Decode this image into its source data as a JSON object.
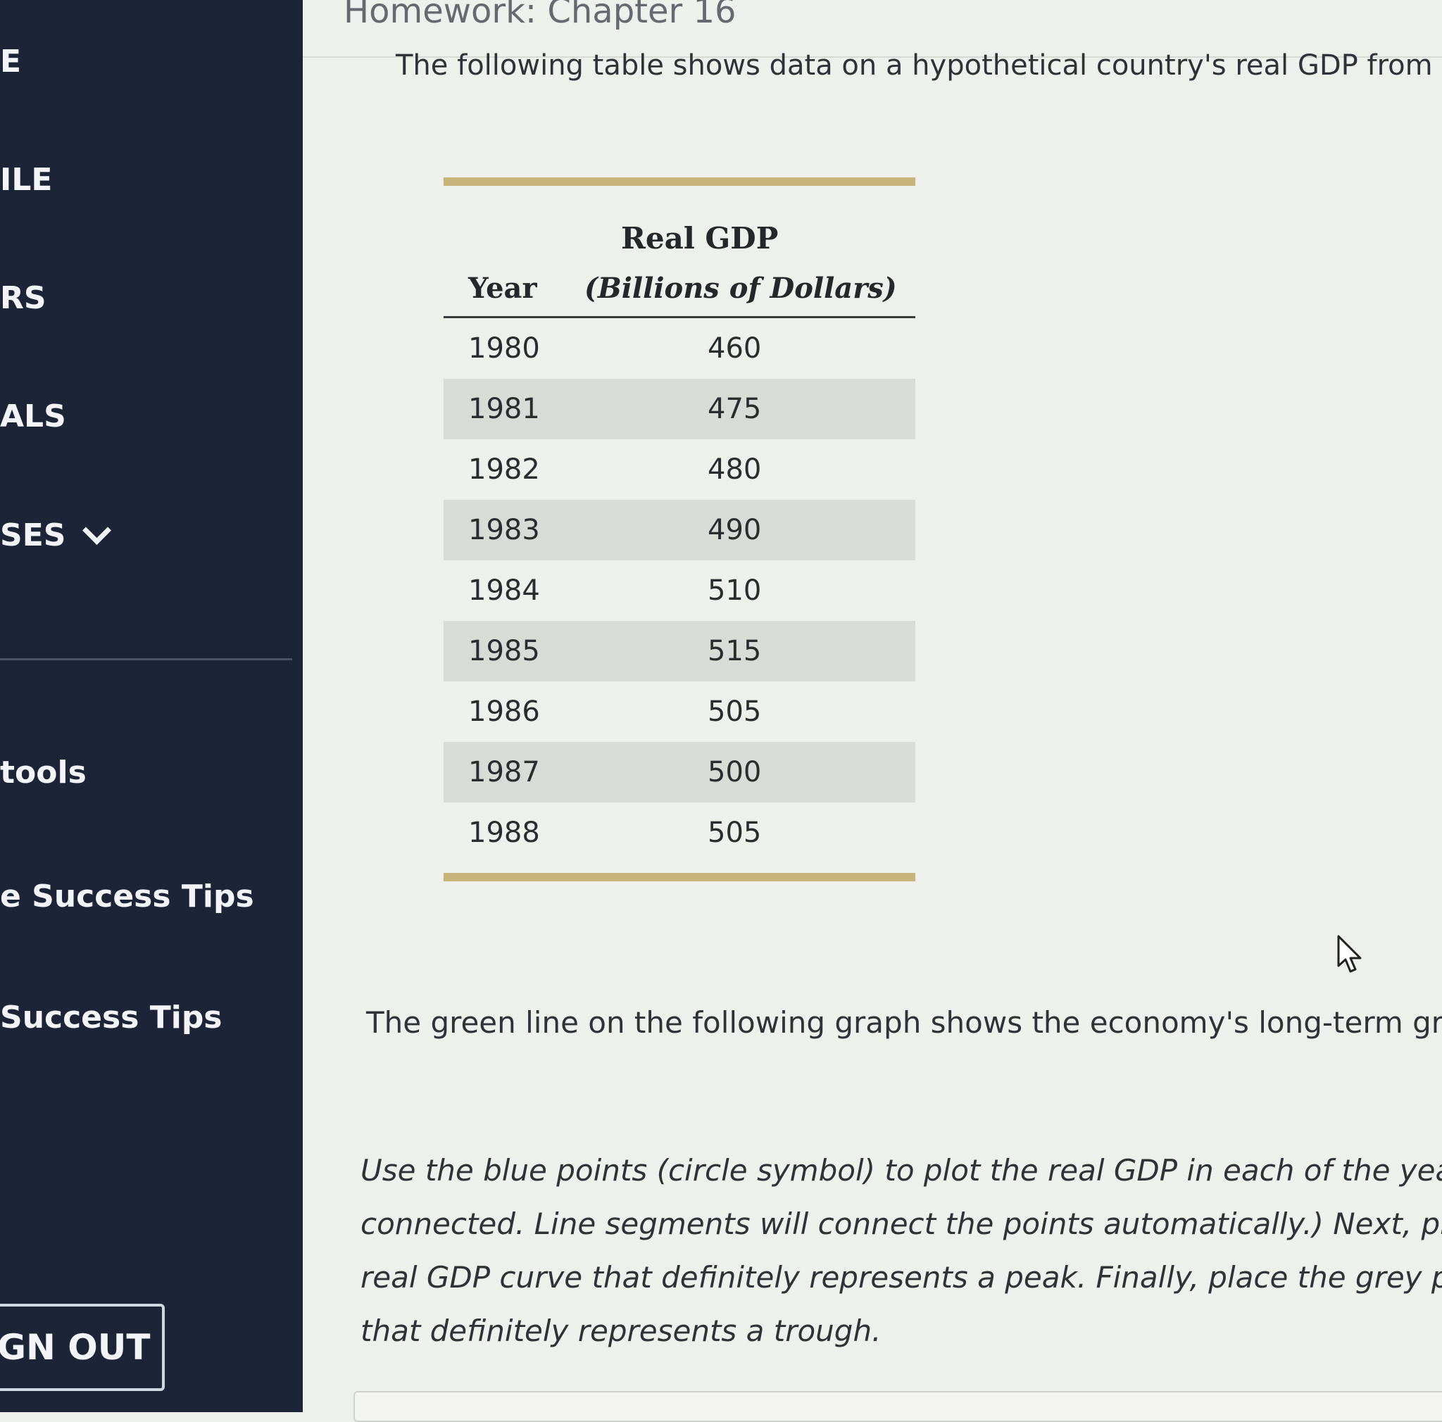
{
  "sidebar": {
    "items": [
      {
        "label": "E"
      },
      {
        "label": "ILE"
      },
      {
        "label": "RS"
      },
      {
        "label": "ALS"
      },
      {
        "label": "SES"
      },
      {
        "label": "tools"
      },
      {
        "label": "e Success Tips"
      },
      {
        "label": "Success Tips"
      }
    ],
    "signout_label": "GN OUT"
  },
  "header": {
    "title": "Homework: Chapter 16"
  },
  "intro_text": "The following table shows data on a hypothetical country's real GDP from",
  "table": {
    "header_top": "Real GDP",
    "col_year": "Year",
    "col_gdp": "(Billions of Dollars)",
    "rows": [
      {
        "year": "1980",
        "gdp": "460"
      },
      {
        "year": "1981",
        "gdp": "475"
      },
      {
        "year": "1982",
        "gdp": "480"
      },
      {
        "year": "1983",
        "gdp": "490"
      },
      {
        "year": "1984",
        "gdp": "510"
      },
      {
        "year": "1985",
        "gdp": "515"
      },
      {
        "year": "1986",
        "gdp": "505"
      },
      {
        "year": "1987",
        "gdp": "500"
      },
      {
        "year": "1988",
        "gdp": "505"
      }
    ]
  },
  "paragraph1": "The green line on the following graph shows the economy's long-term gro",
  "paragraph2": {
    "lines": [
      "Use the blue points (circle symbol) to plot the real GDP in each of the yea",
      "connected. Line segments will connect the points automatically.) Next, pla",
      "real GDP curve that definitely represents a peak. Finally, place the grey po",
      "that definitely represents a trough."
    ]
  }
}
